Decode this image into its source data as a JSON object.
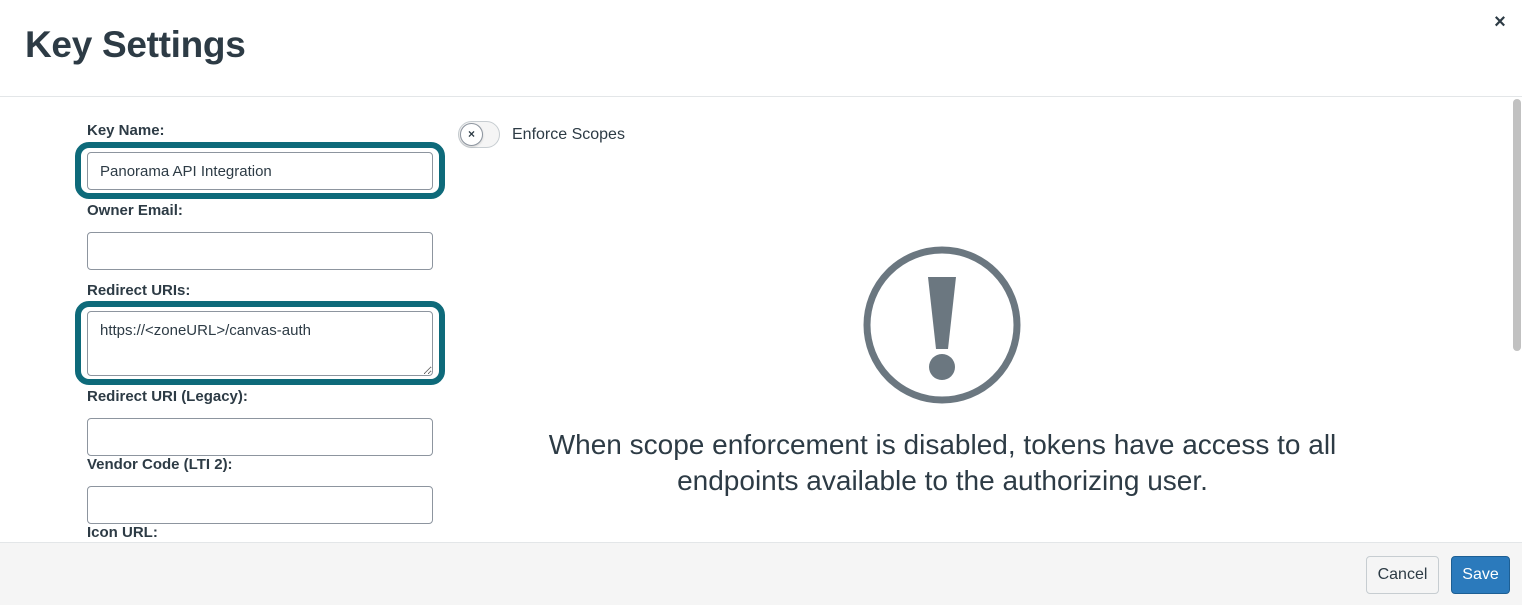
{
  "modal": {
    "title": "Key Settings",
    "close_label": "×"
  },
  "form": {
    "key_name": {
      "label": "Key Name:",
      "value": "Panorama API Integration"
    },
    "owner_email": {
      "label": "Owner Email:",
      "value": ""
    },
    "redirect_uris": {
      "label": "Redirect URIs:",
      "value": "https://<zoneURL>/canvas-auth"
    },
    "redirect_uri_legacy": {
      "label": "Redirect URI (Legacy):",
      "value": ""
    },
    "vendor_code": {
      "label": "Vendor Code (LTI 2):",
      "value": ""
    },
    "icon_url": {
      "label": "Icon URL:"
    }
  },
  "scopes": {
    "toggle_label": "Enforce Scopes",
    "toggle_state": "off",
    "toggle_icon": "×",
    "warning_text": "When scope enforcement is disabled, tokens have access to all endpoints available to the authorizing user."
  },
  "footer": {
    "cancel_label": "Cancel",
    "save_label": "Save"
  },
  "colors": {
    "highlight": "#0e6a7a",
    "primary": "#2b7abc",
    "warning_icon": "#6b7780",
    "text": "#2d3b45"
  }
}
